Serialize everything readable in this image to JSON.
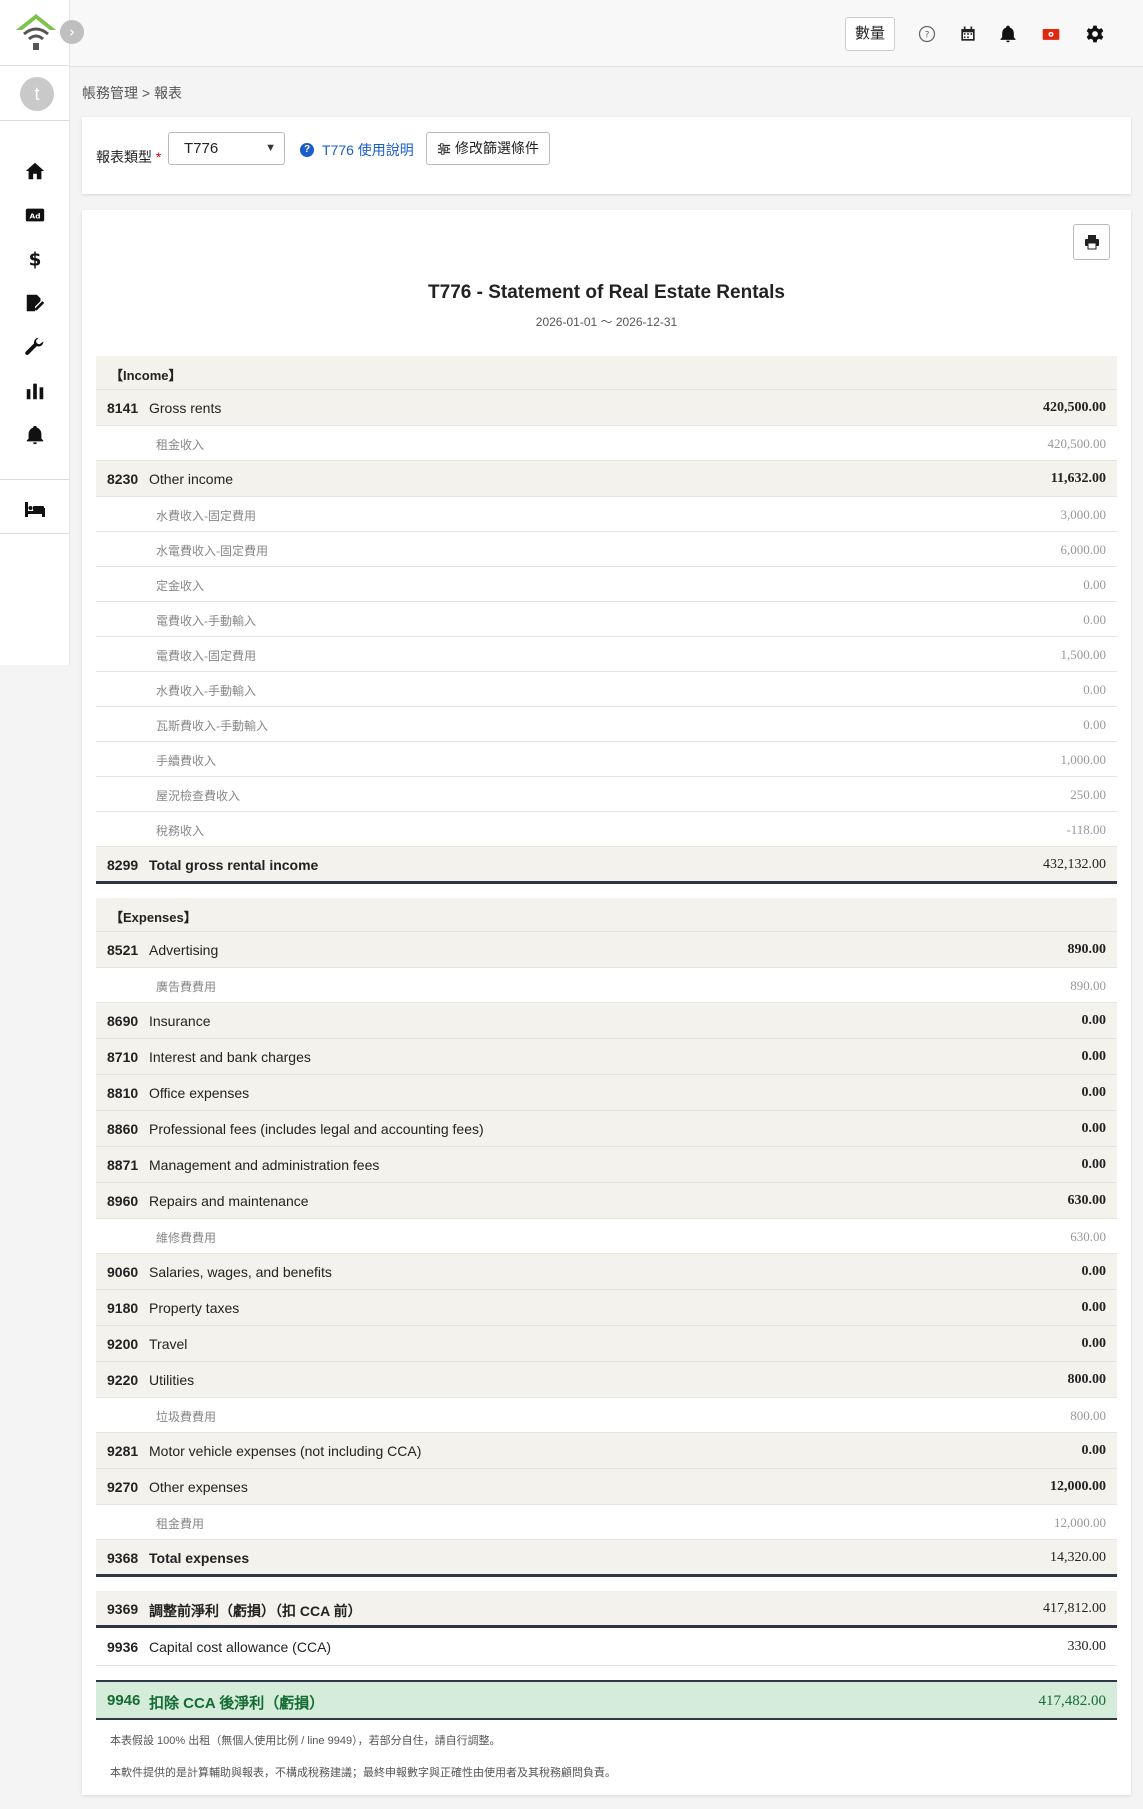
{
  "topbar": {
    "qty_label": "數量",
    "icons": [
      "help-circle-icon",
      "calendar-icon",
      "bell-icon",
      "hong-kong-flag-icon",
      "gear-icon"
    ]
  },
  "sidebar": {
    "avatar_letter": "t",
    "items": [
      "home-icon",
      "ad-icon",
      "dollar-icon",
      "signature-icon",
      "wrench-icon",
      "bar-chart-icon",
      "bell-icon"
    ],
    "bottom_item": "bed-icon"
  },
  "breadcrumb": "帳務管理 > 報表",
  "filter": {
    "label": "報表類型",
    "required_mark": "*",
    "selected": "T776",
    "help_text": "T776 使用說明",
    "modify_button": "修改篩選條件"
  },
  "report": {
    "title": "T776 - Statement of Real Estate Rentals",
    "range": "2026-01-01 ～ 2026-12-31",
    "income_section": "【Income】",
    "expense_section": "【Expenses】",
    "rows_income": [
      {
        "type": "main",
        "code": "8141",
        "label": "Gross rents",
        "amount": "420,500.00"
      },
      {
        "type": "sub",
        "label": "租金收入",
        "amount": "420,500.00"
      },
      {
        "type": "main",
        "code": "8230",
        "label": "Other income",
        "amount": "11,632.00"
      },
      {
        "type": "sub",
        "label": "水費收入-固定費用",
        "amount": "3,000.00"
      },
      {
        "type": "sub",
        "label": "水電費收入-固定費用",
        "amount": "6,000.00"
      },
      {
        "type": "sub",
        "label": "定金收入",
        "amount": "0.00"
      },
      {
        "type": "sub",
        "label": "電費收入-手動輸入",
        "amount": "0.00"
      },
      {
        "type": "sub",
        "label": "電費收入-固定費用",
        "amount": "1,500.00"
      },
      {
        "type": "sub",
        "label": "水費收入-手動輸入",
        "amount": "0.00"
      },
      {
        "type": "sub",
        "label": "瓦斯費收入-手動輸入",
        "amount": "0.00"
      },
      {
        "type": "sub",
        "label": "手續費收入",
        "amount": "1,000.00"
      },
      {
        "type": "sub",
        "label": "屋況檢查費收入",
        "amount": "250.00"
      },
      {
        "type": "sub",
        "label": "稅務收入",
        "amount": "-118.00"
      }
    ],
    "total_income": {
      "code": "8299",
      "label": "Total gross rental income",
      "amount": "432,132.00"
    },
    "rows_expenses": [
      {
        "type": "main",
        "code": "8521",
        "label": "Advertising",
        "amount": "890.00"
      },
      {
        "type": "sub",
        "label": "廣告費費用",
        "amount": "890.00"
      },
      {
        "type": "main",
        "code": "8690",
        "label": "Insurance",
        "amount": "0.00"
      },
      {
        "type": "main",
        "code": "8710",
        "label": "Interest and bank charges",
        "amount": "0.00"
      },
      {
        "type": "main",
        "code": "8810",
        "label": "Office expenses",
        "amount": "0.00"
      },
      {
        "type": "main",
        "code": "8860",
        "label": "Professional fees (includes legal and accounting fees)",
        "amount": "0.00"
      },
      {
        "type": "main",
        "code": "8871",
        "label": "Management and administration fees",
        "amount": "0.00"
      },
      {
        "type": "main",
        "code": "8960",
        "label": "Repairs and maintenance",
        "amount": "630.00"
      },
      {
        "type": "sub",
        "label": "維修費費用",
        "amount": "630.00"
      },
      {
        "type": "main",
        "code": "9060",
        "label": "Salaries, wages, and benefits",
        "amount": "0.00"
      },
      {
        "type": "main",
        "code": "9180",
        "label": "Property taxes",
        "amount": "0.00"
      },
      {
        "type": "main",
        "code": "9200",
        "label": "Travel",
        "amount": "0.00"
      },
      {
        "type": "main",
        "code": "9220",
        "label": "Utilities",
        "amount": "800.00"
      },
      {
        "type": "sub",
        "label": "垃圾費費用",
        "amount": "800.00"
      },
      {
        "type": "main",
        "code": "9281",
        "label": "Motor vehicle expenses (not including CCA)",
        "amount": "0.00"
      },
      {
        "type": "main",
        "code": "9270",
        "label": "Other expenses",
        "amount": "12,000.00"
      },
      {
        "type": "sub",
        "label": "租金費用",
        "amount": "12,000.00"
      }
    ],
    "total_expenses": {
      "code": "9368",
      "label": "Total expenses",
      "amount": "14,320.00"
    },
    "net_before_cca": {
      "code": "9369",
      "label": "調整前淨利（虧損）（扣 CCA 前）",
      "amount": "417,812.00"
    },
    "cca": {
      "code": "9936",
      "label": "Capital cost allowance (CCA)",
      "amount": "330.00"
    },
    "net_after_cca": {
      "code": "9946",
      "label": "扣除 CCA 後淨利（虧損）",
      "amount": "417,482.00"
    },
    "notes": [
      "本表假設 100% 出租（無個人使用比例 / line 9949），若部分自住，請自行調整。",
      "本軟件提供的是計算輔助與報表，不構成稅務建議；最終申報數字與正確性由使用者及其稅務顧問負責。"
    ]
  }
}
